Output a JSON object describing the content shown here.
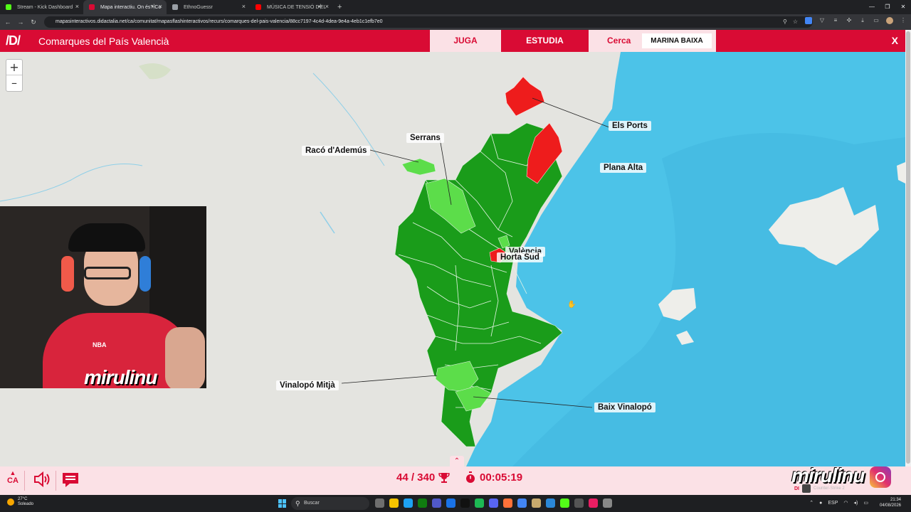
{
  "browser": {
    "tabs": [
      {
        "title": "Stream - Kick Dashboard",
        "favicon_color": "#53fc18",
        "active": false
      },
      {
        "title": "Mapa interactiu. On és? Co",
        "favicon_color": "#d90b34",
        "active": true
      },
      {
        "title": "EthnoGuessr",
        "favicon_color": "#9aa0a6",
        "active": false
      },
      {
        "title": "MÚSICA DE TENSIÓ D'EL",
        "favicon_color": "#ff0000",
        "active": false
      }
    ],
    "new_tab": "+",
    "url": "mapasinteractivos.didactalia.net/ca/comunitat/mapasflashinteractivos/recurs/comarques-del-pais-valencia/88cc7197-4c4d-4dea-9e4a-4eb1c1efb7e0"
  },
  "app": {
    "logo": "/D/",
    "title": "Comarques del País Valencià",
    "tabs": {
      "play": "JUGA",
      "study": "ESTUDIA",
      "find": "Cerca"
    },
    "target": "MARINA BAIXA",
    "close": "X"
  },
  "map": {
    "zoom_in": "+",
    "zoom_out": "–",
    "labels": {
      "els_ports": "Els Ports",
      "plana_alta": "Plana Alta",
      "serrans": "Serrans",
      "raco": "Racó d'Ademús",
      "valencia": "València",
      "horta_sud": "Horta Sud",
      "vinalopo_mitja": "Vinalopó Mitjà",
      "baix_vinalopo": "Baix Vinalopó"
    },
    "colors": {
      "correct": "#1a9c1a",
      "correct_retry": "#5cdd4a",
      "wrong": "#ee1c1c",
      "sea": "#4cc3e8",
      "land": "#e4e4e0"
    }
  },
  "stream_overlay": {
    "watermark": "mirulinu",
    "shirt_number": "NBA"
  },
  "footer": {
    "language": "CA",
    "score": "44 / 340",
    "timer": "00:05:19",
    "brand": "mirulinu",
    "game_label": "Counter-Strike 2",
    "game_short": "DI"
  },
  "taskbar": {
    "weather_temp": "27°C",
    "weather_desc": "Soleado",
    "search_placeholder": "Buscar",
    "lang": "ESP",
    "time": "21:34",
    "date": "04/08/2026"
  }
}
